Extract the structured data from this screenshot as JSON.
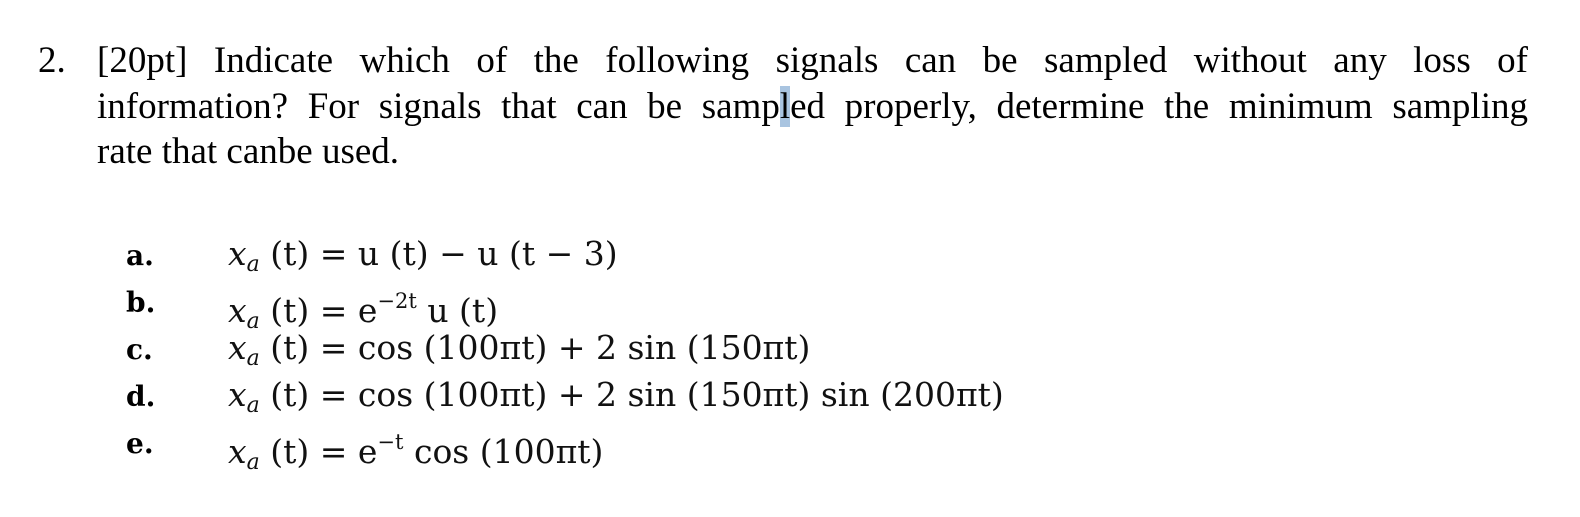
{
  "question": {
    "number": "2.",
    "points": "[20pt]",
    "lines": [
      "Indicate which of the following signals can be sampled without any loss of",
      "information? For signals that can be samp",
      "l",
      "ed properly, determine the minimum sampling",
      "rate that canbe used."
    ],
    "highlight_color": "#a9c4e0"
  },
  "signals": [
    {
      "label": "a.",
      "lhs": "x",
      "sub": "a",
      "arg": " (t) = ",
      "rhs": "u (t) − u (t − 3)"
    },
    {
      "label": "b.",
      "lhs": "x",
      "sub": "a",
      "arg": " (t) = ",
      "rhs_pre": "e",
      "sup": "−2t",
      "rhs": " u (t)"
    },
    {
      "label": "c.",
      "lhs": "x",
      "sub": "a",
      "arg": " (t) = ",
      "rhs": "cos (100πt) + 2 sin (150πt)"
    },
    {
      "label": "d.",
      "lhs": "x",
      "sub": "a",
      "arg": " (t) = ",
      "rhs": "cos (100πt) + 2 sin (150πt) sin (200πt)"
    },
    {
      "label": "e.",
      "lhs": "x",
      "sub": "a",
      "arg": " (t) = ",
      "rhs_pre": "e",
      "sup": "−t",
      "rhs": " cos (100πt)"
    }
  ]
}
